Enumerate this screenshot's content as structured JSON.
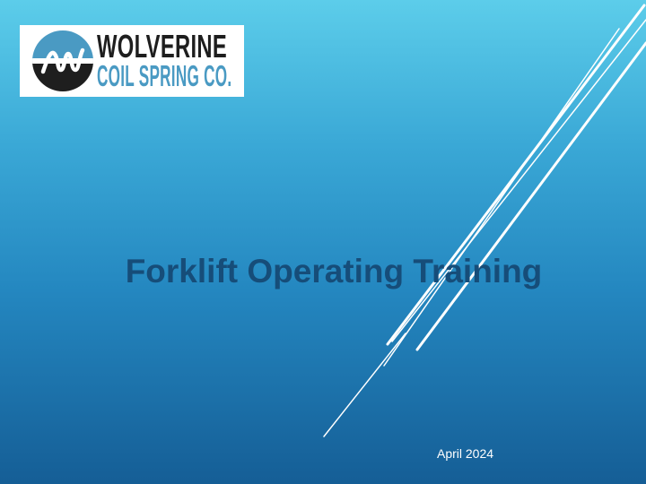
{
  "slide": {
    "title": "Forklift Operating Training",
    "date": "April 2024"
  },
  "logo": {
    "line1": "WOLVERINE",
    "line2": "COIL SPRING CO.",
    "icon": "wolverine-w-spring-icon"
  },
  "colors": {
    "background_top": "#5ccdea",
    "background_bottom": "#155e96",
    "title": "#164d79",
    "logo_dark": "#1e1e1e",
    "logo_blue": "#4a9ac3"
  }
}
